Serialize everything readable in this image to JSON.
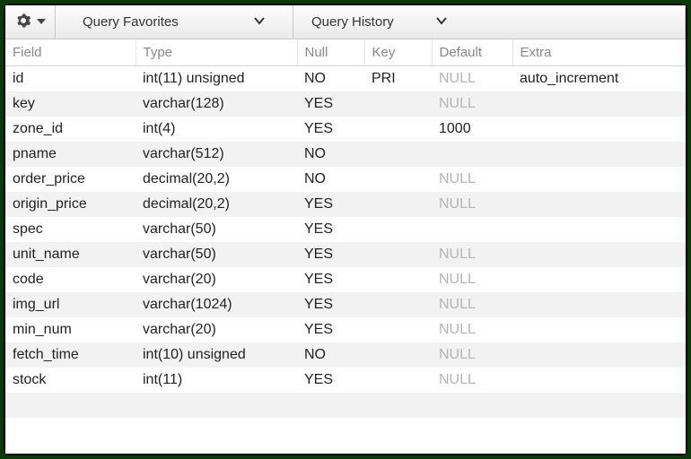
{
  "toolbar": {
    "favorites_label": "Query Favorites",
    "history_label": "Query History"
  },
  "columns": {
    "field": "Field",
    "type": "Type",
    "null": "Null",
    "key": "Key",
    "default": "Default",
    "extra": "Extra"
  },
  "rows": [
    {
      "field": "id",
      "type": "int(11) unsigned",
      "null": "NO",
      "key": "PRI",
      "default": "NULL",
      "default_is_null": true,
      "extra": "auto_increment"
    },
    {
      "field": "key",
      "type": "varchar(128)",
      "null": "YES",
      "key": "",
      "default": "NULL",
      "default_is_null": true,
      "extra": ""
    },
    {
      "field": "zone_id",
      "type": "int(4)",
      "null": "YES",
      "key": "",
      "default": "1000",
      "default_is_null": false,
      "extra": ""
    },
    {
      "field": "pname",
      "type": "varchar(512)",
      "null": "NO",
      "key": "",
      "default": "",
      "default_is_null": false,
      "extra": ""
    },
    {
      "field": "order_price",
      "type": "decimal(20,2)",
      "null": "NO",
      "key": "",
      "default": "NULL",
      "default_is_null": true,
      "extra": ""
    },
    {
      "field": "origin_price",
      "type": "decimal(20,2)",
      "null": "YES",
      "key": "",
      "default": "NULL",
      "default_is_null": true,
      "extra": ""
    },
    {
      "field": "spec",
      "type": "varchar(50)",
      "null": "YES",
      "key": "",
      "default": "",
      "default_is_null": false,
      "extra": ""
    },
    {
      "field": "unit_name",
      "type": "varchar(50)",
      "null": "YES",
      "key": "",
      "default": "NULL",
      "default_is_null": true,
      "extra": ""
    },
    {
      "field": "code",
      "type": "varchar(20)",
      "null": "YES",
      "key": "",
      "default": "NULL",
      "default_is_null": true,
      "extra": ""
    },
    {
      "field": "img_url",
      "type": "varchar(1024)",
      "null": "YES",
      "key": "",
      "default": "NULL",
      "default_is_null": true,
      "extra": ""
    },
    {
      "field": "min_num",
      "type": "varchar(20)",
      "null": "YES",
      "key": "",
      "default": "NULL",
      "default_is_null": true,
      "extra": ""
    },
    {
      "field": "fetch_time",
      "type": "int(10) unsigned",
      "null": "NO",
      "key": "",
      "default": "NULL",
      "default_is_null": true,
      "extra": ""
    },
    {
      "field": "stock",
      "type": "int(11)",
      "null": "YES",
      "key": "",
      "default": "NULL",
      "default_is_null": true,
      "extra": ""
    }
  ]
}
